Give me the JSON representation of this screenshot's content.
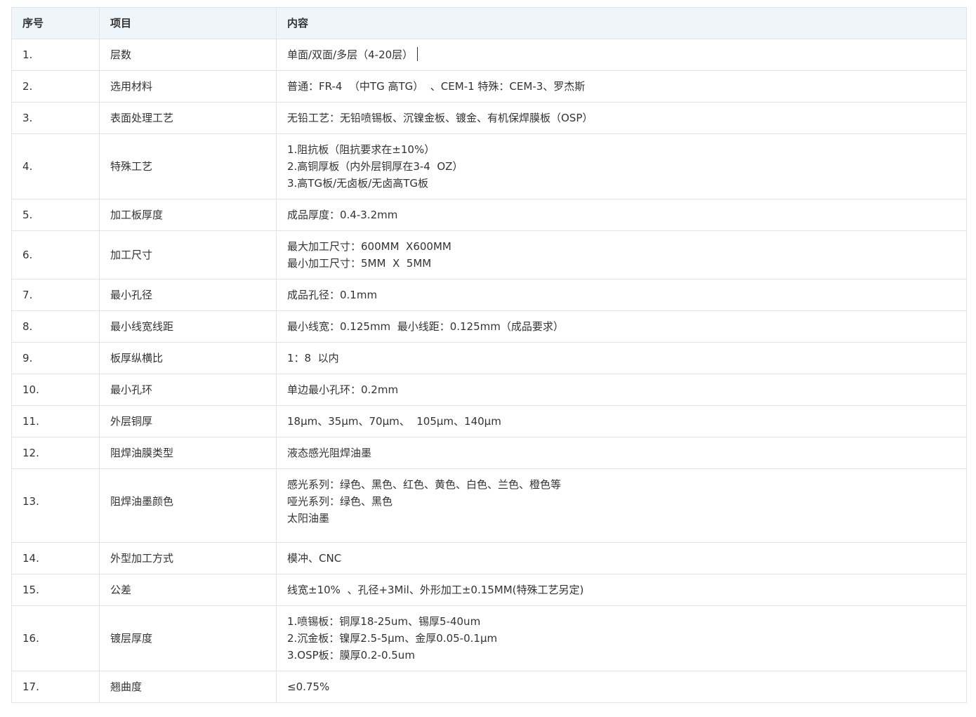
{
  "headers": [
    "序号",
    "项目",
    "内容"
  ],
  "rows": [
    {
      "no": "1.",
      "item": "层数",
      "content": [
        "单面/双面/多层（4-20层）"
      ]
    },
    {
      "no": "2.",
      "item": "选用材料",
      "content": [
        "普通：FR-4  （中TG 高TG）  、CEM-1 特殊：CEM-3、罗杰斯"
      ]
    },
    {
      "no": "3.",
      "item": "表面处理工艺",
      "content": [
        "无铅工艺：无铅喷锡板、沉镍金板、镀金、有机保焊膜板（OSP）"
      ]
    },
    {
      "no": "4.",
      "item": "特殊工艺",
      "content": [
        "1.阻抗板（阻抗要求在±10%）",
        "2.高铜厚板（内外层铜厚在3-4  OZ）",
        "3.高TG板/无卤板/无卤高TG板"
      ]
    },
    {
      "no": "5.",
      "item": "加工板厚度",
      "content": [
        "成品厚度：0.4-3.2mm"
      ]
    },
    {
      "no": "6.",
      "item": "加工尺寸",
      "content": [
        "最大加工尺寸：600MM  X600MM",
        "最小加工尺寸：5MM  X  5MM"
      ]
    },
    {
      "no": "7.",
      "item": "最小孔径",
      "content": [
        "成品孔径：0.1mm"
      ]
    },
    {
      "no": "8.",
      "item": "最小线宽线距",
      "content": [
        "最小线宽：0.125mm  最小线距：0.125mm（成品要求）"
      ]
    },
    {
      "no": "9.",
      "item": "板厚纵横比",
      "content": [
        "1：8  以内"
      ]
    },
    {
      "no": "10.",
      "item": "最小孔环",
      "content": [
        "单边最小孔环：0.2mm"
      ]
    },
    {
      "no": "11.",
      "item": "外层铜厚",
      "content": [
        "18μm、35μm、70μm、  105μm、140μm"
      ]
    },
    {
      "no": "12.",
      "item": "阻焊油膜类型",
      "content": [
        "液态感光阻焊油墨"
      ]
    },
    {
      "no": "13.",
      "item": "阻焊油墨颜色",
      "content": [
        "感光系列：绿色、黑色、红色、黄色、白色、兰色、橙色等",
        "哑光系列：绿色、黑色",
        "太阳油墨"
      ]
    },
    {
      "no": "14.",
      "item": "外型加工方式",
      "content": [
        "模冲、CNC"
      ]
    },
    {
      "no": "15.",
      "item": "公差",
      "content": [
        "线宽±10%  、孔径+3Mil、外形加工±0.15MM(特殊工艺另定)"
      ]
    },
    {
      "no": "16.",
      "item": "镀层厚度",
      "content": [
        "1.喷锡板：铜厚18-25um、锡厚5-40um",
        "2.沉金板：镍厚2.5-5μm、金厚0.05-0.1μm",
        "3.OSP板：膜厚0.2-0.5um"
      ]
    },
    {
      "no": "17.",
      "item": "翘曲度",
      "content": [
        "≤0.75%"
      ]
    }
  ]
}
